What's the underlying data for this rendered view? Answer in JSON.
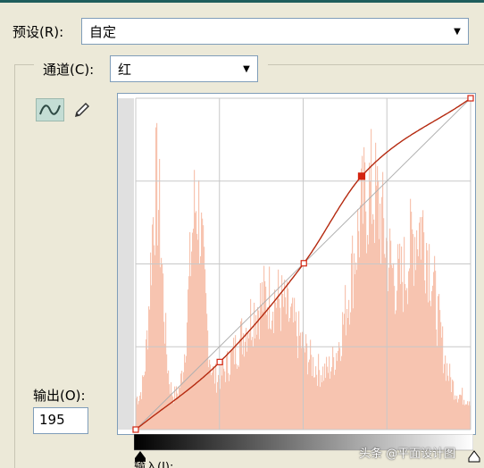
{
  "dialog": {
    "preset_label": "预设(R):",
    "preset_value": "自定",
    "channel_label": "通道(C):",
    "channel_value": "红",
    "output_label": "输出(O):",
    "output_value": "195",
    "input_label_partial": "输入(I):"
  },
  "curve_points": [
    [
      0,
      0
    ],
    [
      64,
      52
    ],
    [
      128,
      128
    ],
    [
      172,
      195
    ],
    [
      255,
      255
    ]
  ],
  "selected_point_index": 3,
  "watermark": "头条 @平面设计图",
  "colors": {
    "curve": "#b52a10",
    "histogram": "#f7c4b0",
    "point": "#d32410"
  },
  "icons": [
    "curve-tool-icon",
    "pencil-tool-icon",
    "dropdown-arrow-icon",
    "black-point-slider-icon",
    "white-point-slider-icon"
  ]
}
